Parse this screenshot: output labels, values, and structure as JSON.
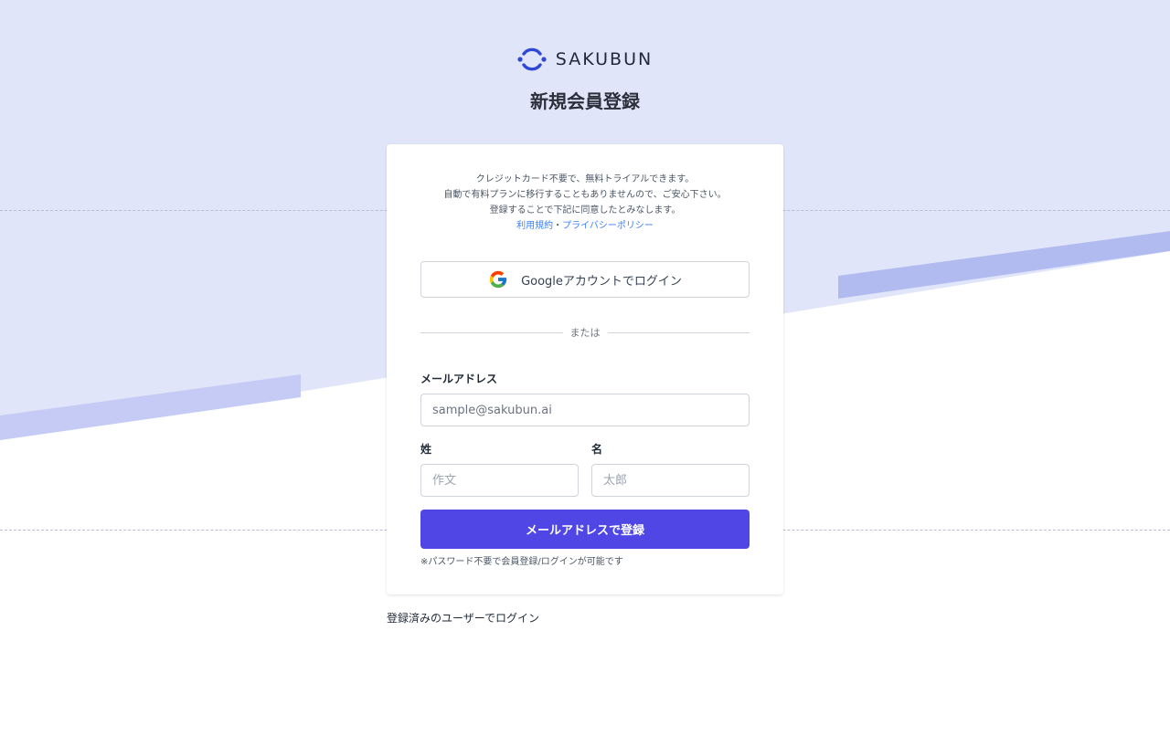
{
  "brand": {
    "name": "SAKUBUN",
    "logo_icon": "sakubun-logo-icon",
    "accent_color": "#2f48d6"
  },
  "page": {
    "title": "新規会員登録"
  },
  "notice": {
    "line1": "クレジットカード不要で、無料トライアルできます。",
    "line2": "自動で有料プランに移行することもありませんので、ご安心下さい。",
    "line3": "登録することで下記に同意したとみなします。",
    "terms_link": "利用規約",
    "separator": "・",
    "privacy_link": "プライバシーポリシー"
  },
  "google": {
    "label": "Googleアカウントでログイン",
    "icon": "google-icon"
  },
  "divider": {
    "text": "または"
  },
  "form": {
    "email_label": "メールアドレス",
    "email_placeholder": "sample@sakubun.ai",
    "last_name_label": "姓",
    "last_name_placeholder": "作文",
    "first_name_label": "名",
    "first_name_placeholder": "太郎",
    "submit_label": "メールアドレスで登録",
    "hint": "※パスワード不要で会員登録/ログインが可能です"
  },
  "footer": {
    "login_link": "登録済みのユーザーでログイン"
  },
  "colors": {
    "background_band": "#e1e5fa",
    "stripe": "#c5cbf5",
    "primary_button": "#4f46e5",
    "link": "#3b82f6"
  }
}
